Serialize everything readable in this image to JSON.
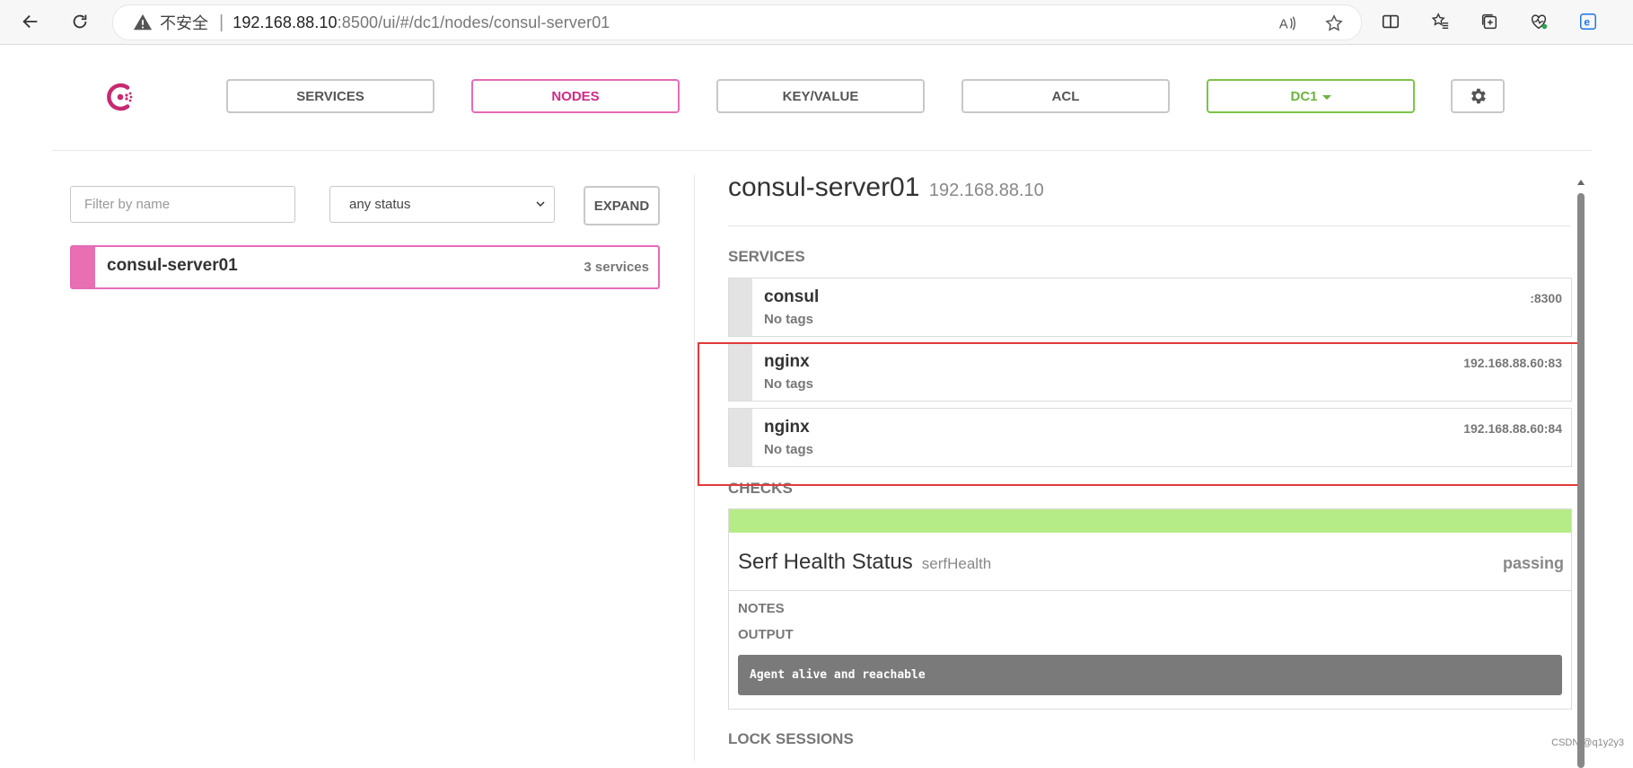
{
  "browser": {
    "security_label": "不安全",
    "url_separator": "|",
    "url_host": "192.168.88.10",
    "url_path": ":8500/ui/#/dc1/nodes/consul-server01"
  },
  "nav": {
    "services": "SERVICES",
    "nodes": "NODES",
    "key_value": "KEY/VALUE",
    "acl": "ACL",
    "datacenter": "DC1",
    "active": "NODES"
  },
  "filters": {
    "name_placeholder": "Filter by name",
    "status_selected": "any status",
    "expand_label": "EXPAND"
  },
  "node_list": [
    {
      "name": "consul-server01",
      "services_count": "3 services"
    }
  ],
  "node_detail": {
    "name": "consul-server01",
    "address": "192.168.88.10",
    "services_heading": "SERVICES",
    "services": [
      {
        "name": "consul",
        "tags": "No tags",
        "address": ":8300"
      },
      {
        "name": "nginx",
        "tags": "No tags",
        "address": "192.168.88.60:83"
      },
      {
        "name": "nginx",
        "tags": "No tags",
        "address": "192.168.88.60:84"
      }
    ],
    "checks_heading": "CHECKS",
    "check": {
      "name": "Serf Health Status",
      "id": "serfHealth",
      "status": "passing",
      "notes_label": "NOTES",
      "output_label": "OUTPUT",
      "output": "Agent alive and reachable",
      "status_color": "#b6ec88"
    },
    "lock_sessions_heading": "LOCK SESSIONS"
  },
  "colors": {
    "accent_pink": "#d22a86",
    "accent_green": "#6cb33e",
    "highlight_red": "#e23a3a"
  },
  "watermark": "CSDN @q1y2y3"
}
